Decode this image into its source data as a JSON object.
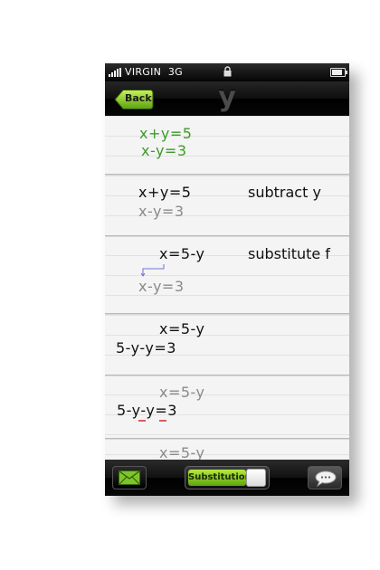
{
  "status": {
    "carrier": "VIRGIN",
    "network": "3G",
    "icons": [
      "signal-icon",
      "lock-icon",
      "battery-icon"
    ]
  },
  "nav": {
    "back_label": "Back",
    "title": "y"
  },
  "steps": [
    {
      "lines": [
        "x+y=5",
        "x-y=3"
      ],
      "note": ""
    },
    {
      "lines": [
        "x+y=5",
        "x-y=3"
      ],
      "note": "subtract y"
    },
    {
      "lines": [
        "x=5-y",
        "x-y=3"
      ],
      "note": "substitute f"
    },
    {
      "lines": [
        "x=5-y",
        "5-y-y=3"
      ],
      "note": ""
    },
    {
      "lines": [
        "x=5-y",
        "5-y-y=3"
      ],
      "note": ""
    },
    {
      "lines": [
        "x=5-y"
      ],
      "note": ""
    }
  ],
  "toolbar": {
    "toggle_label": "Substitution",
    "toggle_on": true,
    "icons": [
      "mail-icon",
      "speech-bubble-icon"
    ]
  },
  "colors": {
    "accent_green": "#3c9a28",
    "toggle_green": "#8cd12a",
    "faded_text": "#8a8a8a"
  }
}
